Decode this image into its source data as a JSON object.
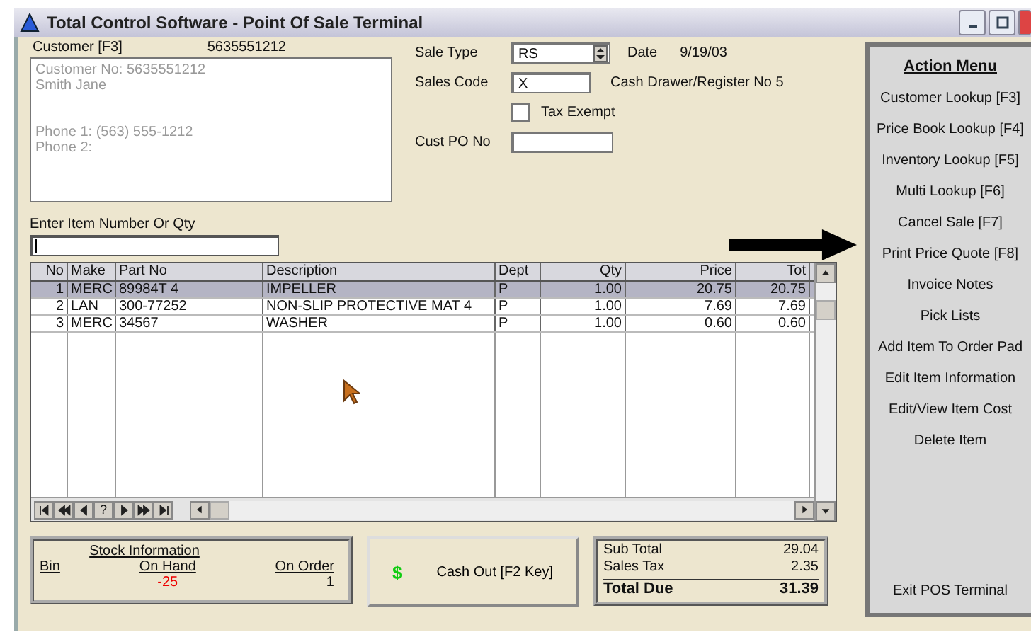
{
  "window": {
    "title": "Total Control Software - Point Of Sale Terminal"
  },
  "customer": {
    "label": "Customer [F3]",
    "number": "5635551212",
    "name_lines": [
      "Customer No: 5635551212",
      "Smith Jane"
    ],
    "phone_lines": [
      "Phone 1: (563) 555-1212",
      "Phone 2:"
    ]
  },
  "sale": {
    "sale_type_label": "Sale Type",
    "sale_type": "RS",
    "date_label": "Date",
    "date": "9/19/03",
    "sales_code_label": "Sales Code",
    "sales_code": "X",
    "register": "Cash Drawer/Register No 5",
    "tax_exempt": {
      "label": "Tax Exempt",
      "checked": false
    },
    "cust_po_label": "Cust PO No"
  },
  "item_entry": {
    "label": "Enter Item Number Or Qty"
  },
  "table": {
    "columns": [
      "No",
      "Make",
      "Part No",
      "Description",
      "Dept",
      "Qty",
      "Price",
      "Tot"
    ],
    "rows": [
      {
        "cells": [
          "1",
          "MERC",
          "89984T 4",
          "IMPELLER",
          "P",
          "1.00",
          "20.75",
          "20.75"
        ],
        "selected": true
      },
      {
        "cells": [
          "2",
          "LAN",
          "300-77252",
          "NON-SLIP PROTECTIVE MAT 4",
          "P",
          "1.00",
          "7.69",
          "7.69"
        ],
        "selected": false
      },
      {
        "cells": [
          "3",
          "MERC",
          "34567",
          "WASHER",
          "P",
          "1.00",
          "0.60",
          "0.60"
        ],
        "selected": false
      }
    ],
    "nav": [
      {
        "kind": "first"
      },
      {
        "kind": "prev-page"
      },
      {
        "kind": "prev"
      },
      {
        "kind": "help",
        "label": "?"
      },
      {
        "kind": "next"
      },
      {
        "kind": "next-page"
      },
      {
        "kind": "last"
      }
    ]
  },
  "stock": {
    "title": "Stock Information",
    "bin_label": "Bin",
    "on_hand_label": "On Hand",
    "on_order_label": "On Order",
    "on_hand": "-25",
    "on_order": "1"
  },
  "cash_out": {
    "symbol": "$",
    "label": "Cash Out [F2 Key]"
  },
  "totals": [
    {
      "label": "Sub Total",
      "value": "29.04",
      "kind": "line"
    },
    {
      "label": "Sales Tax",
      "value": "2.35",
      "kind": "line"
    },
    {
      "label": "Total Due",
      "value": "31.39",
      "kind": "total"
    }
  ],
  "action_menu": {
    "title": "Action Menu",
    "items": [
      "Customer Lookup [F3]",
      "Price Book Lookup [F4]",
      "Inventory Lookup [F5]",
      "Multi Lookup [F6]",
      "Cancel Sale [F7]",
      "Print Price Quote [F8]",
      "Invoice Notes",
      "Pick Lists",
      "Add Item To Order Pad",
      "Edit Item Information",
      "Edit/View Item Cost",
      "Delete Item"
    ],
    "exit": "Exit POS Terminal"
  }
}
